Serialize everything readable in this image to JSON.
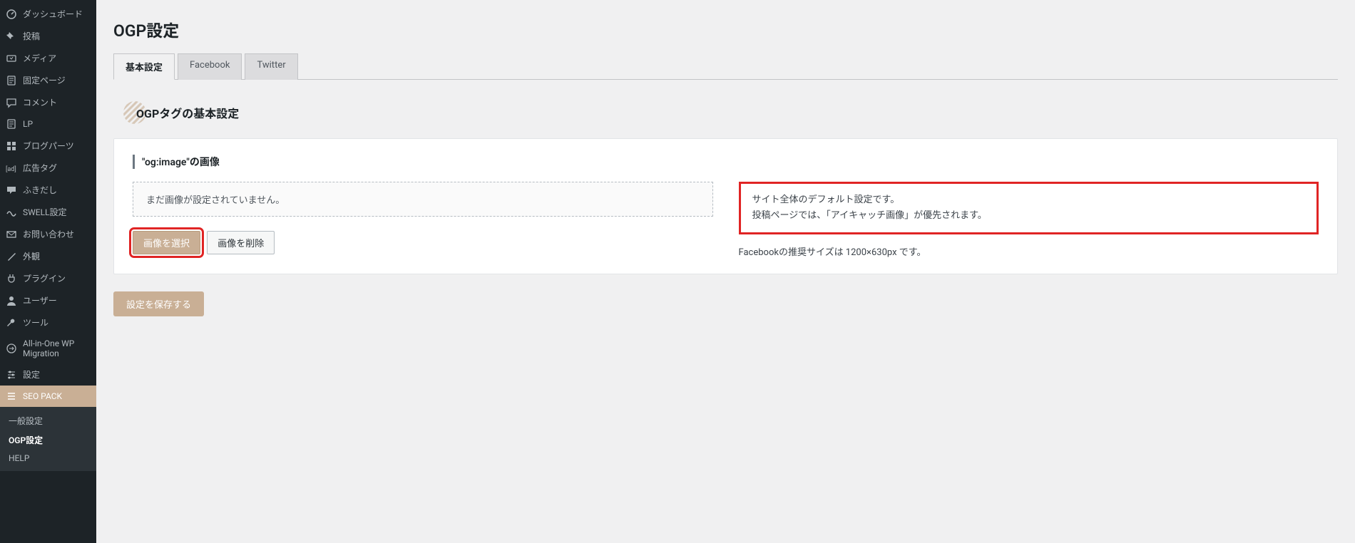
{
  "sidebar": {
    "items": [
      {
        "icon": "dashboard",
        "label": "ダッシュボード"
      },
      {
        "icon": "pin",
        "label": "投稿"
      },
      {
        "icon": "media",
        "label": "メディア"
      },
      {
        "icon": "page",
        "label": "固定ページ"
      },
      {
        "icon": "comment",
        "label": "コメント"
      },
      {
        "icon": "page",
        "label": "LP"
      },
      {
        "icon": "grid",
        "label": "ブログパーツ"
      },
      {
        "icon": "ad",
        "label": "広告タグ"
      },
      {
        "icon": "bubble",
        "label": "ふきだし"
      },
      {
        "icon": "swell",
        "label": "SWELL設定"
      },
      {
        "icon": "mail",
        "label": "お問い合わせ"
      },
      {
        "icon": "brush",
        "label": "外観"
      },
      {
        "icon": "plug",
        "label": "プラグイン"
      },
      {
        "icon": "user",
        "label": "ユーザー"
      },
      {
        "icon": "wrench",
        "label": "ツール"
      },
      {
        "icon": "migrate",
        "label": "All-in-One WP Migration"
      },
      {
        "icon": "sliders",
        "label": "設定"
      },
      {
        "icon": "list",
        "label": "SEO PACK",
        "current": true
      }
    ],
    "submenu": [
      "一般設定",
      "OGP設定",
      "HELP"
    ],
    "submenu_active_index": 1
  },
  "page": {
    "title": "OGP設定",
    "tabs": [
      "基本設定",
      "Facebook",
      "Twitter"
    ],
    "active_tab_index": 0,
    "section_heading": "OGPタグの基本設定",
    "card_label": "\"og:image\"の画像",
    "placeholder_text": "まだ画像が設定されていません。",
    "select_image_btn": "画像を選択",
    "delete_image_btn": "画像を削除",
    "note_line1": "サイト全体のデフォルト設定です。",
    "note_line2": "投稿ページでは、「アイキャッチ画像」が優先されます。",
    "hint": "Facebookの推奨サイズは 1200×630px です。",
    "save_btn": "設定を保存する"
  },
  "colors": {
    "accent": "#c9af95",
    "highlight": "#e02424"
  }
}
